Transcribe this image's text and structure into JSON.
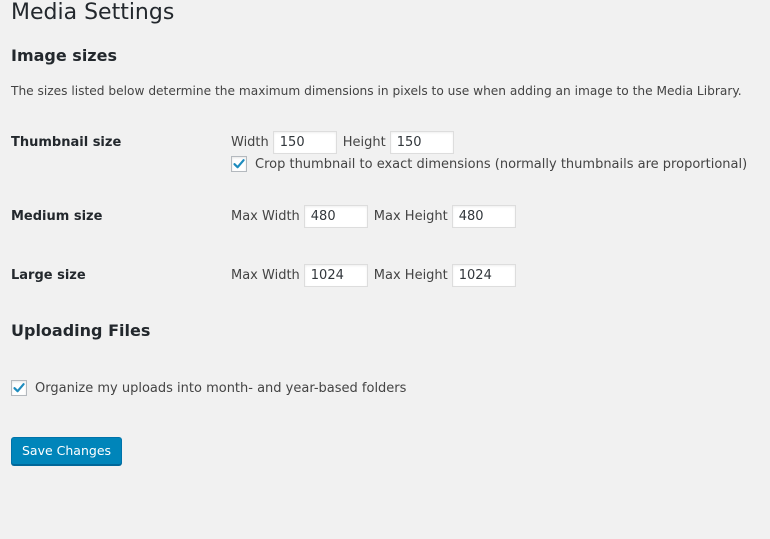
{
  "page": {
    "title": "Media Settings"
  },
  "image_sizes": {
    "heading": "Image sizes",
    "description": "The sizes listed below determine the maximum dimensions in pixels to use when adding an image to the Media Library.",
    "thumbnail": {
      "label": "Thumbnail size",
      "width_label": "Width",
      "width_value": "150",
      "height_label": "Height",
      "height_value": "150",
      "crop_label": "Crop thumbnail to exact dimensions (normally thumbnails are proportional)",
      "crop_checked": true
    },
    "medium": {
      "label": "Medium size",
      "max_width_label": "Max Width",
      "max_width_value": "480",
      "max_height_label": "Max Height",
      "max_height_value": "480"
    },
    "large": {
      "label": "Large size",
      "max_width_label": "Max Width",
      "max_width_value": "1024",
      "max_height_label": "Max Height",
      "max_height_value": "1024"
    }
  },
  "uploading": {
    "heading": "Uploading Files",
    "organize_label": "Organize my uploads into month- and year-based folders",
    "organize_checked": true
  },
  "actions": {
    "save_label": "Save Changes"
  },
  "colors": {
    "background": "#f1f1f1",
    "primary_button": "#0085ba",
    "checkmark": "#1e8cbe"
  }
}
